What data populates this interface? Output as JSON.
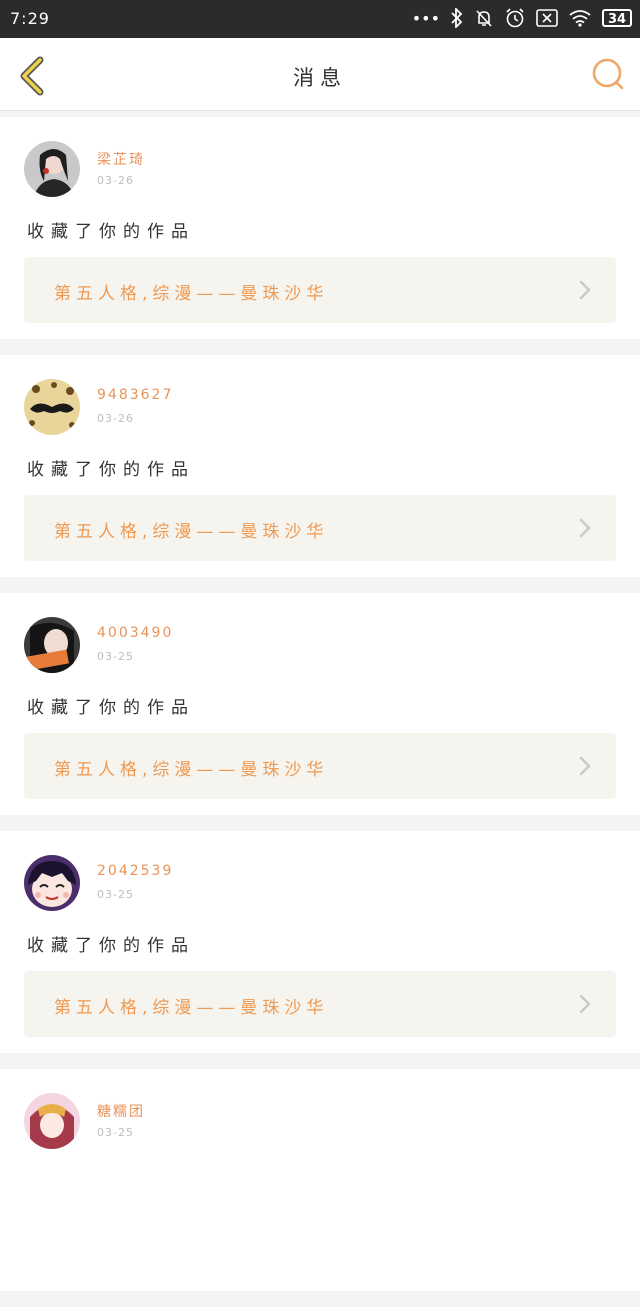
{
  "status_bar": {
    "time": "7:29",
    "icons": [
      "more-icon",
      "bluetooth-icon",
      "bell-off-icon",
      "alarm-icon",
      "sim-x-icon",
      "wifi-icon"
    ],
    "battery": "34"
  },
  "header": {
    "title": "消息",
    "back_icon": "chevron-left-icon",
    "search_icon": "search-icon",
    "accent_color": "#f0b24a"
  },
  "messages": [
    {
      "user": "梁芷琦",
      "date": "03-26",
      "action": "收藏了你的作品",
      "work_title": "第五人格,综漫——曼珠沙华",
      "avatar": "avatar-photo-girl"
    },
    {
      "user": "9483627",
      "date": "03-26",
      "action": "收藏了你的作品",
      "work_title": "第五人格,综漫——曼珠沙华",
      "avatar": "avatar-mustache"
    },
    {
      "user": "4003490",
      "date": "03-25",
      "action": "收藏了你的作品",
      "work_title": "第五人格,综漫——曼珠沙华",
      "avatar": "avatar-photo-girl-2"
    },
    {
      "user": "2042539",
      "date": "03-25",
      "action": "收藏了你的作品",
      "work_title": "第五人格,综漫——曼珠沙华",
      "avatar": "avatar-cartoon"
    },
    {
      "user": "糖糯团",
      "date": "03-25",
      "action": "",
      "work_title": "",
      "avatar": "avatar-anime"
    }
  ]
}
